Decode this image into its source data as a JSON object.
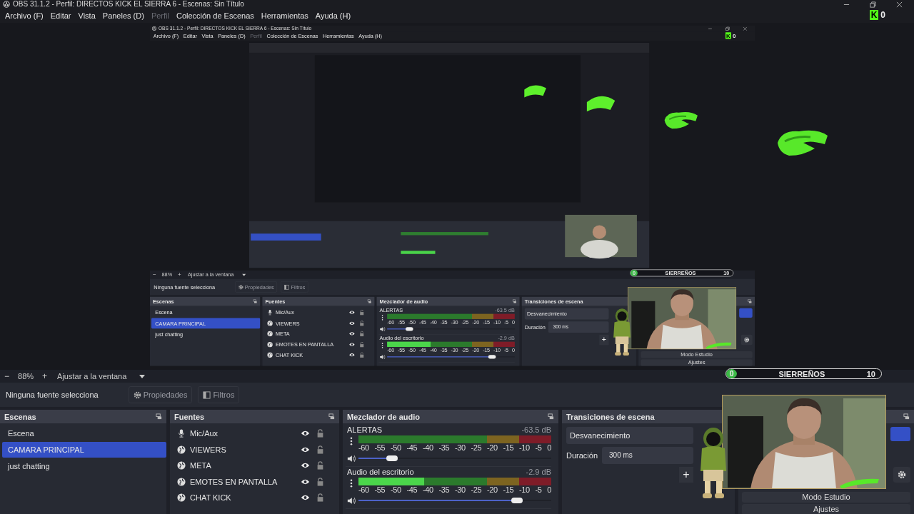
{
  "window": {
    "title": "OBS 31.1.2 - Perfil: DIRECTOS KICK EL SIERRA 6 - Escenas: Sin Título",
    "menu": [
      {
        "label": "Archivo (F)",
        "disabled": false
      },
      {
        "label": "Editar",
        "disabled": false
      },
      {
        "label": "Vista",
        "disabled": false
      },
      {
        "label": "Paneles (D)",
        "disabled": false
      },
      {
        "label": "Perfil",
        "disabled": true
      },
      {
        "label": "Colección de Escenas",
        "disabled": false
      },
      {
        "label": "Herramientas",
        "disabled": false
      },
      {
        "label": "Ayuda (H)",
        "disabled": false
      }
    ],
    "kick_widget": {
      "logo": "K",
      "count": "0"
    },
    "zoom_bar": {
      "zoom_out": "−",
      "value": "88%",
      "zoom_in": "+",
      "fit": "Ajustar a la ventana"
    },
    "source_label": "Ninguna fuente selecciona",
    "source_buttons": [
      {
        "label": "Propiedades",
        "kind": "gear"
      },
      {
        "label": "Filtros",
        "kind": "filter"
      }
    ],
    "scenes": {
      "title": "Escenas",
      "items": [
        {
          "label": "Escena",
          "selected": false
        },
        {
          "label": "CAMARA PRINCIPAL",
          "selected": true
        },
        {
          "label": "just chatting",
          "selected": false
        }
      ]
    },
    "sources": {
      "title": "Fuentes",
      "items": [
        {
          "label": "Mic/Aux",
          "kind": "mic",
          "visible": true
        },
        {
          "label": "VIEWERS",
          "kind": "browser",
          "visible": true
        },
        {
          "label": "META",
          "kind": "browser",
          "visible": true
        },
        {
          "label": "EMOTES EN PANTALLA",
          "kind": "browser",
          "visible": true
        },
        {
          "label": "CHAT KICK",
          "kind": "browser",
          "visible": true
        }
      ]
    },
    "mixer": {
      "title": "Mezclador de audio",
      "channels": [
        {
          "name": "ALERTAS",
          "reading": "-63.5 dB",
          "meter": {
            "level": 0
          },
          "volume": {
            "level": 0.18
          },
          "scale": [
            "-60",
            "-55",
            "-50",
            "-45",
            "-40",
            "-35",
            "-30",
            "-25",
            "-20",
            "-15",
            "-10",
            "-5",
            "0"
          ]
        },
        {
          "name": "Audio del escritorio",
          "reading": "-2.9 dB",
          "meter": {
            "level": 0.34
          },
          "volume": {
            "level": 0.83
          },
          "scale": [
            "-60",
            "-55",
            "-50",
            "-45",
            "-40",
            "-35",
            "-30",
            "-25",
            "-20",
            "-15",
            "-10",
            "-5",
            "0"
          ]
        }
      ]
    },
    "transitions": {
      "title": "Transiciones de escena",
      "type": "Desvanecimiento",
      "duration_label": "Duración",
      "duration": "300 ms",
      "add": "+"
    },
    "controls": {
      "buttons": [
        {
          "label": "Modo Estudio"
        },
        {
          "label": "Ajustes"
        }
      ]
    },
    "goal_bar": {
      "start": "0",
      "label": "SIERREÑOS",
      "end": "10",
      "level": 0
    },
    "preview": {
      "window": {
        "title": "OBS 31.1.2 - Perfil: DIRECTOS KICK EL SIERRA 6 - Escenas: Sin Título",
        "menu": [
          {
            "label": "Archivo (F)",
            "disabled": false
          },
          {
            "label": "Editar",
            "disabled": false
          },
          {
            "label": "Vista",
            "disabled": false
          },
          {
            "label": "Paneles (D)",
            "disabled": false
          },
          {
            "label": "Perfil",
            "disabled": true
          },
          {
            "label": "Colección de Escenas",
            "disabled": false
          },
          {
            "label": "Herramientas",
            "disabled": false
          },
          {
            "label": "Ayuda (H)",
            "disabled": false
          }
        ],
        "kick_widget": {
          "logo": "K",
          "count": "0"
        },
        "zoom_bar": {
          "zoom_out": "−",
          "value": "88%",
          "zoom_in": "+",
          "fit": "Ajustar a la ventana"
        },
        "source_label": "Ninguna fuente selecciona",
        "source_buttons": [
          {
            "label": "Propiedades",
            "kind": "gear"
          },
          {
            "label": "Filtros",
            "kind": "filter"
          }
        ],
        "scenes": {
          "title": "Escenas",
          "items": [
            {
              "label": "Escena",
              "selected": false
            },
            {
              "label": "CAMARA PRINCIPAL",
              "selected": true
            },
            {
              "label": "just chatting",
              "selected": false
            }
          ]
        },
        "sources": {
          "title": "Fuentes",
          "items": [
            {
              "label": "Mic/Aux",
              "kind": "mic",
              "visible": true
            },
            {
              "label": "VIEWERS",
              "kind": "browser",
              "visible": true
            },
            {
              "label": "META",
              "kind": "browser",
              "visible": true
            },
            {
              "label": "EMOTES EN PANTALLA",
              "kind": "browser",
              "visible": true
            },
            {
              "label": "CHAT KICK",
              "kind": "browser",
              "visible": true
            }
          ]
        },
        "mixer": {
          "title": "Mezclador de audio",
          "channels": [
            {
              "name": "ALERTAS",
              "reading": "-63.5 dB",
              "meter": {
                "level": 0
              },
              "volume": {
                "level": 0.18
              },
              "scale": [
                "-60",
                "-55",
                "-50",
                "-45",
                "-40",
                "-35",
                "-30",
                "-25",
                "-20",
                "-15",
                "-10",
                "-5",
                "0"
              ]
            },
            {
              "name": "Audio del escritorio",
              "reading": "-2.9 dB",
              "meter": {
                "level": 0.34
              },
              "volume": {
                "level": 0.83
              },
              "scale": [
                "-60",
                "-55",
                "-50",
                "-45",
                "-40",
                "-35",
                "-30",
                "-25",
                "-20",
                "-15",
                "-10",
                "-5",
                "0"
              ]
            }
          ]
        },
        "transitions": {
          "title": "Transiciones de escena",
          "type": "Desvanecimiento",
          "duration_label": "Duración",
          "duration": "300 ms",
          "add": "+"
        },
        "controls": {
          "buttons": [
            {
              "label": "Modo Estudio"
            },
            {
              "label": "Ajustes"
            }
          ]
        },
        "goal_bar": {
          "start": "0",
          "label": "SIERREÑOS",
          "end": "10",
          "level": 0
        }
      }
    }
  }
}
